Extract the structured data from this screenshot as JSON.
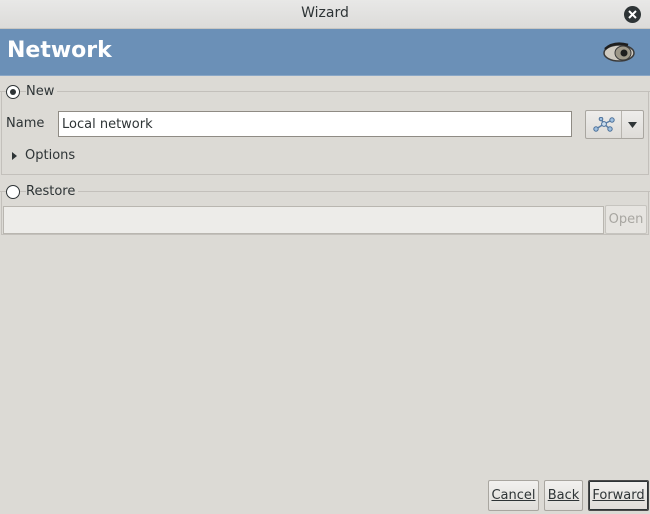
{
  "window": {
    "title": "Wizard"
  },
  "banner": {
    "heading": "Network",
    "logo_icon": "eye-logo-icon",
    "color": "#6b90b7"
  },
  "new_section": {
    "radio_label": "New",
    "selected": true,
    "name_label": "Name",
    "name_value": "Local network",
    "network_icon": "network-icon",
    "options_label": "Options"
  },
  "restore_section": {
    "radio_label": "Restore",
    "selected": false,
    "path_value": "",
    "open_label": "Open"
  },
  "buttons": {
    "cancel": "Cancel",
    "back": "Back",
    "forward": "Forward"
  }
}
